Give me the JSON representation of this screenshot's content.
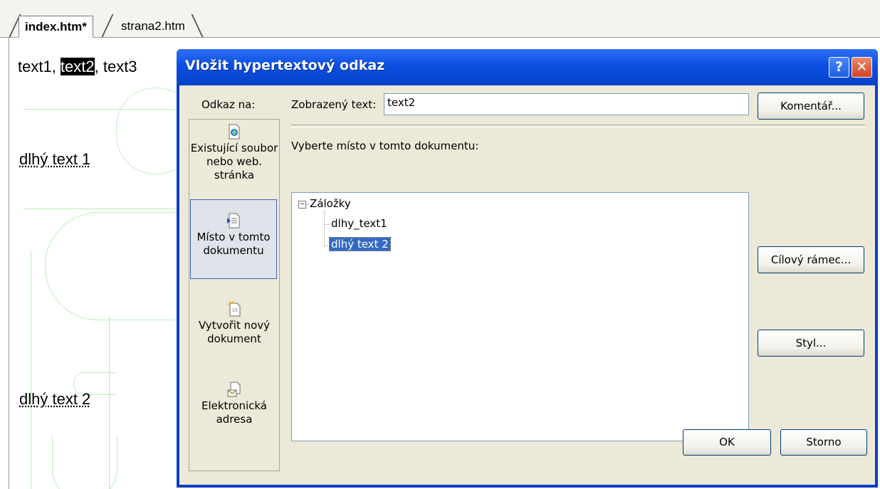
{
  "editor": {
    "tabs": [
      {
        "label": "index.htm*",
        "active": true
      },
      {
        "label": "strana2.htm",
        "active": false
      }
    ],
    "content": {
      "line1_before": "text1, ",
      "line1_selected": "text2",
      "line1_after": ", text3",
      "anchor1": "dlhý text 1",
      "anchor2": "dlhý text 2"
    }
  },
  "dialog": {
    "title": "Vložit hypertextový odkaz",
    "help_button": "?",
    "close_button": "✕",
    "link_to_label": "Odkaz na:",
    "places": [
      {
        "label": "Existující soubor nebo web. stránka",
        "icon": "existing-file-icon",
        "active": false
      },
      {
        "label": "Místo v tomto dokumentu",
        "icon": "place-in-document-icon",
        "active": true
      },
      {
        "label": "Vytvořit nový dokument",
        "icon": "new-document-icon",
        "active": false
      },
      {
        "label": "Elektronická adresa",
        "icon": "email-address-icon",
        "active": false
      }
    ],
    "display_text_label": "Zobrazený text:",
    "display_text_value": "text2",
    "comment_button": "Komentář...",
    "select_place_label": "Vyberte místo v tomto dokumentu:",
    "tree": {
      "root": "Záložky",
      "children": [
        "dlhy_text1",
        "dlhý text 2"
      ],
      "selected": "dlhý text 2"
    },
    "target_frame_button": "Cílový rámec...",
    "style_button": "Styl...",
    "ok_button": "OK",
    "cancel_button": "Storno",
    "colors": {
      "title_bar": "#0a4ee1",
      "face": "#ece9d8",
      "selection": "#316ac5",
      "close": "#d2421f"
    }
  }
}
